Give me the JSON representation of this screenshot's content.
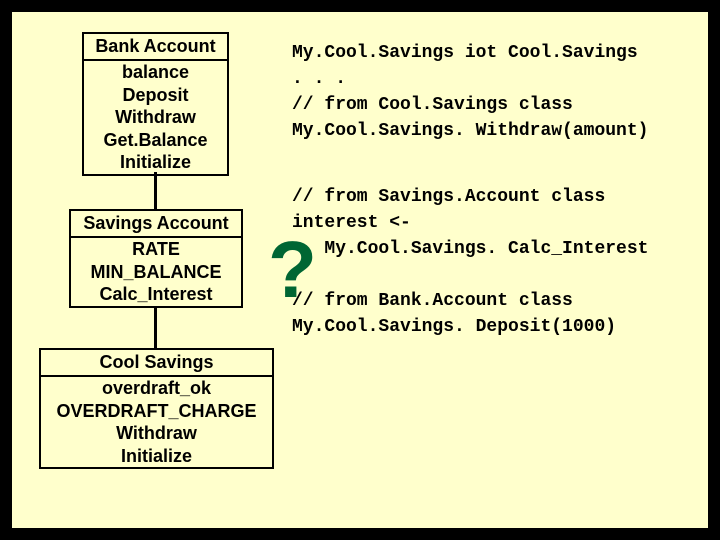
{
  "boxes": {
    "bank": {
      "title": "Bank Account",
      "rows": [
        "balance",
        "Deposit",
        "Withdraw",
        "Get.Balance",
        "Initialize"
      ]
    },
    "savings": {
      "title": "Savings Account",
      "rows": [
        "RATE",
        "MIN_BALANCE",
        "Calc_Interest"
      ]
    },
    "cool": {
      "title": "Cool Savings",
      "rows": [
        "overdraft_ok",
        "OVERDRAFT_CHARGE",
        "Withdraw",
        "Initialize"
      ]
    }
  },
  "code1": "My.Cool.Savings iot Cool.Savings\n. . .\n// from Cool.Savings class\nMy.Cool.Savings. Withdraw(amount)",
  "code2": "// from Savings.Account class\ninterest <-\n   My.Cool.Savings. Calc_Interest\n\n// from Bank.Account class\nMy.Cool.Savings. Deposit(1000)",
  "qmark": "?"
}
